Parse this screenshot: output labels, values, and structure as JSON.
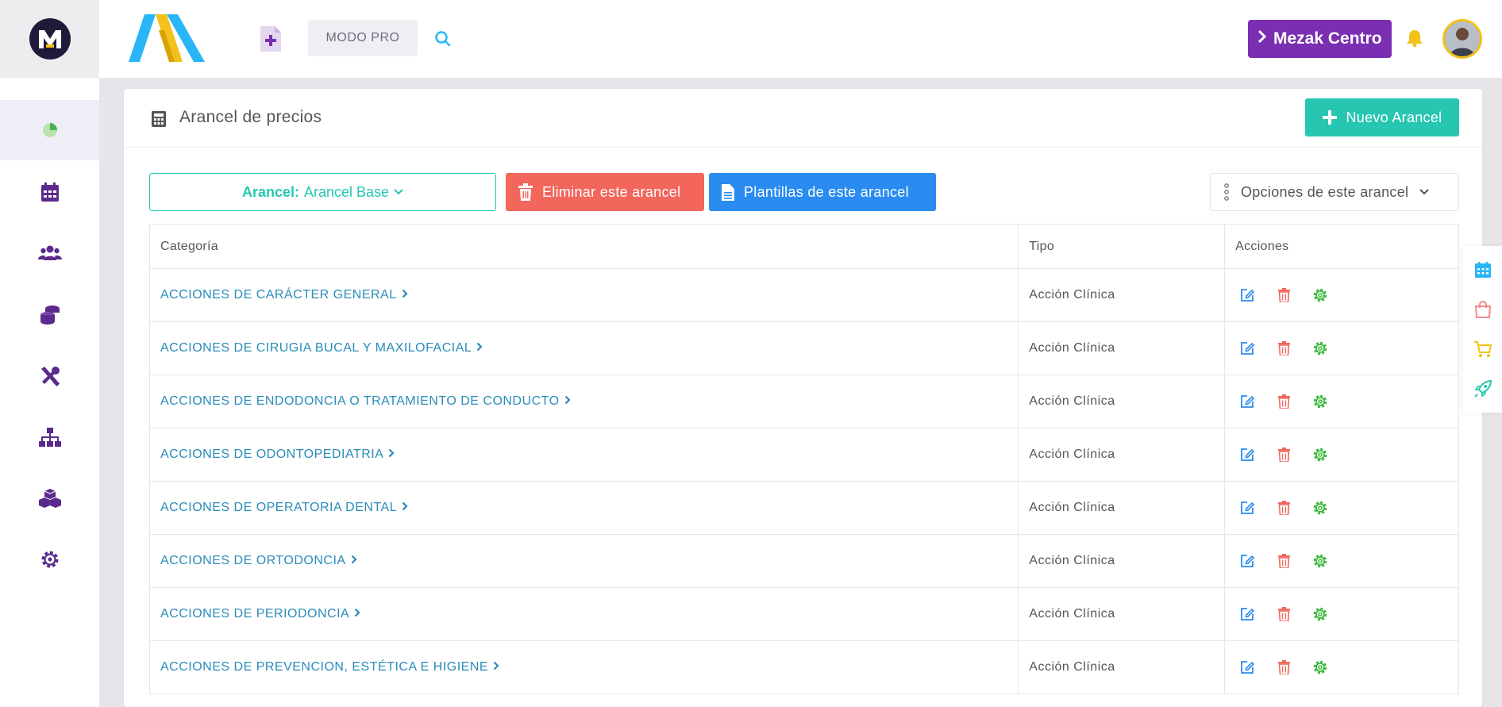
{
  "header": {
    "modo_pro_label": "MODO PRO",
    "center_name": "Mezak Centro"
  },
  "sidebar": {
    "items": [
      {
        "name": "dashboard",
        "icon": "pie-chart-icon"
      },
      {
        "name": "calendar",
        "icon": "calendar-icon"
      },
      {
        "name": "patients",
        "icon": "users-icon"
      },
      {
        "name": "finance",
        "icon": "coins-icon"
      },
      {
        "name": "tools",
        "icon": "tools-icon"
      },
      {
        "name": "organization",
        "icon": "sitemap-icon"
      },
      {
        "name": "inventory",
        "icon": "cubes-icon"
      },
      {
        "name": "settings",
        "icon": "gear-icon"
      }
    ]
  },
  "page": {
    "title": "Arancel de precios",
    "new_button": "Nuevo Arancel",
    "arancel_label": "Arancel:",
    "arancel_value": "Arancel Base",
    "delete_button": "Eliminar este arancel",
    "templates_button": "Plantillas de este arancel",
    "options_button": "Opciones de este arancel"
  },
  "table": {
    "headers": [
      "Categoría",
      "Tipo",
      "Acciones"
    ],
    "rows": [
      {
        "categoria": "ACCIONES DE CARÁCTER GENERAL",
        "tipo": "Acción Clínica"
      },
      {
        "categoria": "ACCIONES DE CIRUGIA BUCAL Y MAXILOFACIAL",
        "tipo": "Acción Clínica"
      },
      {
        "categoria": "ACCIONES DE ENDODONCIA O TRATAMIENTO DE CONDUCTO",
        "tipo": "Acción Clínica"
      },
      {
        "categoria": "ACCIONES DE ODONTOPEDIATRIA",
        "tipo": "Acción Clínica"
      },
      {
        "categoria": "ACCIONES DE OPERATORIA DENTAL",
        "tipo": "Acción Clínica"
      },
      {
        "categoria": "ACCIONES DE ORTODONCIA",
        "tipo": "Acción Clínica"
      },
      {
        "categoria": "ACCIONES DE PERIODONCIA",
        "tipo": "Acción Clínica"
      },
      {
        "categoria": "ACCIONES DE PREVENCION, ESTÉTICA E HIGIENE",
        "tipo": "Acción Clínica"
      }
    ]
  },
  "colors": {
    "brand_purple": "#7a2fb2",
    "sidebar_icon": "#5b2a8c",
    "teal": "#26c6b0",
    "danger": "#f2665c",
    "primary": "#2a8cf0",
    "link": "#2a8cb8"
  }
}
